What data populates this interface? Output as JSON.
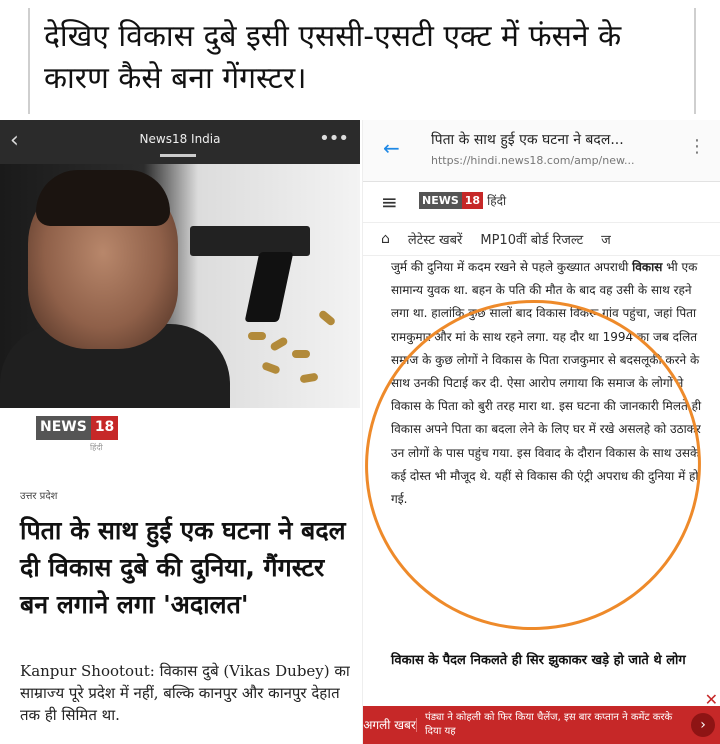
{
  "caption": {
    "text": "देखिए विकास दुबे इसी एससी-एसटी एक्ट में फंसने के कारण कैसे बना गेंगस्टर।"
  },
  "left_screen": {
    "topbar_title": "News18 India",
    "logo_news": "NEWS",
    "logo_18": "18",
    "logo_sub": "हिंदी",
    "kicker": "उत्तर प्रदेश",
    "headline": "पिता के साथ हुई एक घटना ने बदल दी विकास दुबे की दुनिया, गैंगस्टर बन लगाने लगा 'अदालत'",
    "summary": "Kanpur Shootout: विकास दुबे (Vikas Dubey) का साम्राज्य पूरे प्रदेश में नहीं, बल्कि कानपुर और कानपुर देहात तक ही सिमित था."
  },
  "right_screen": {
    "address_title": "पिता के साथ हुई एक घटना ने बदल...",
    "address_url": "https://hindi.news18.com/amp/new...",
    "logo_news": "NEWS",
    "logo_18": "18",
    "logo_hindi": "हिंदी",
    "nav": [
      "लेटेस्ट खबरें",
      "MP10वीं बोर्ड रिजल्ट",
      "ज"
    ],
    "article_lead": "जुर्म की दुनिया में कदम रखने से पहले कुख्यात अपराधी ",
    "article_name": "विकास",
    "article_rest": " भी एक सामान्य युवक था. बहन के पति की मौत के बाद वह उसी के साथ रहने लगा था. हालांकि कुछ सालों बाद विकास विकरू गांव पहुंचा, जहां पिता रामकुमार और मां के साथ रहने लगा. यह दौर था 1994 का जब दलित समाज के कुछ लोगों ने विकास के पिता राजकुमार से बदसलूकी करने के साथ उनकी पिटाई कर दी. ऐसा आरोप लगाया कि समाज के लोगों ने विकास के पिता को बुरी तरह मारा था. इस घटना की जानकारी मिलते ही विकास अपने पिता का बदला लेने के लिए घर में रखे असलहे को उठाकर उन लोगों के पास पहुंच गया. इस विवाद के दौरान विकास के साथ उसके कई दोस्त भी मौजूद थे. यहीं से विकास की एंट्री अपराध की दुनिया में हो गई.",
    "subhead": "विकास के पैदल निकलते ही सिर झुकाकर खड़े हो जाते थे लोग",
    "next_label": "अगली खबर",
    "next_text": "पंड्या ने कोहली को फिर किया चैलेंज, इस बार कप्तान ने कमेंट करके दिया यह",
    "accent": "#c62828",
    "highlight_circle": "#ee8a2a"
  }
}
